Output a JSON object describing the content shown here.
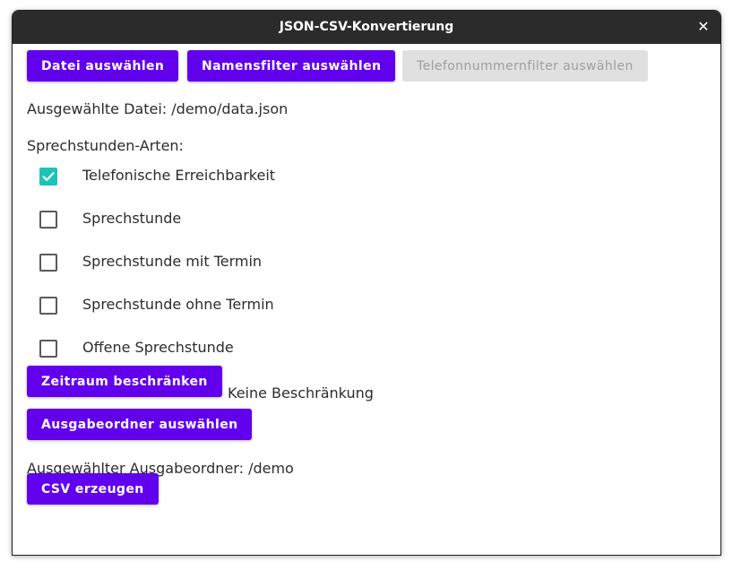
{
  "window": {
    "title": "JSON-CSV-Konvertierung"
  },
  "buttons": {
    "select_file": "Datei auswählen",
    "select_name_filter": "Namensfilter auswählen",
    "select_phone_filter": "Telefonnummernfilter auswählen",
    "limit_period": "Zeitraum beschränken",
    "select_output_folder": "Ausgabeordner auswählen",
    "create_csv": "CSV erzeugen"
  },
  "labels": {
    "selected_file": "Ausgewählte Datei: /demo/data.json",
    "consultation_types": "Sprechstunden-Arten:",
    "period_status": "Keine Beschränkung",
    "selected_output_folder": "Ausgewählter Ausgabeordner: /demo"
  },
  "consultation_types": [
    {
      "label": "Telefonische Erreichbarkeit",
      "checked": true
    },
    {
      "label": "Sprechstunde",
      "checked": false
    },
    {
      "label": "Sprechstunde mit Termin",
      "checked": false
    },
    {
      "label": "Sprechstunde ohne Termin",
      "checked": false
    },
    {
      "label": "Offene Sprechstunde",
      "checked": false
    }
  ],
  "colors": {
    "primary": "#6200ee",
    "checkbox_checked": "#18c5b8",
    "titlebar": "#2b2b2b",
    "disabled": "#e0e0e0"
  },
  "icons": {
    "close": "close-icon",
    "check": "check-icon"
  }
}
